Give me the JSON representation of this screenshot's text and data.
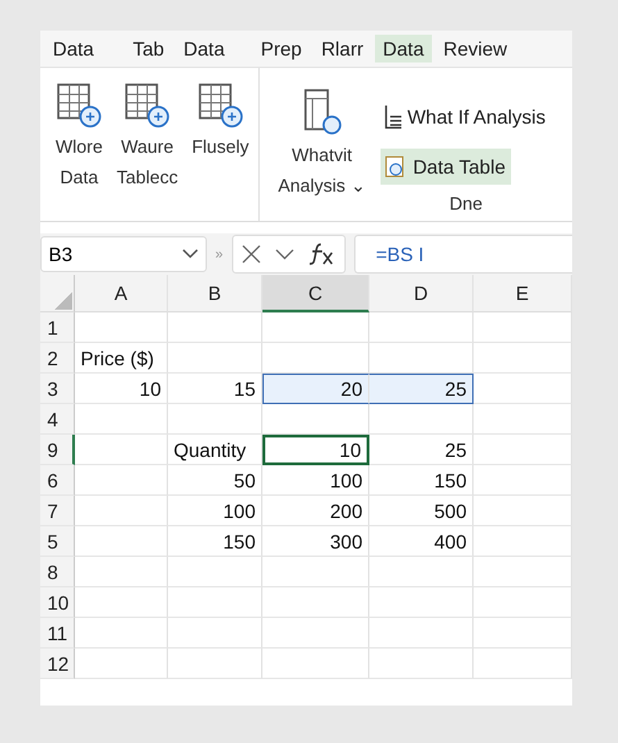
{
  "tabs": [
    {
      "label": "Data",
      "selected": false
    },
    {
      "label": "Tab",
      "selected": false
    },
    {
      "label": "Data",
      "selected": false
    },
    {
      "label": "Prep",
      "selected": false
    },
    {
      "label": "Rlarr",
      "selected": false
    },
    {
      "label": "Data",
      "selected": true
    },
    {
      "label": "Review",
      "selected": false
    }
  ],
  "ribbon": {
    "left_buttons": [
      {
        "lines": [
          "Wlore",
          "Data"
        ]
      },
      {
        "lines": [
          "Waure",
          "Tablecc"
        ]
      },
      {
        "lines": [
          "Flusely"
        ]
      }
    ],
    "analysis_button": {
      "lines": [
        "Whatvit",
        "Analysis"
      ],
      "caret": "⌄"
    },
    "small_buttons": [
      {
        "label": "What If Analysis",
        "selected": false
      },
      {
        "label": "Data Table",
        "selected": true
      }
    ],
    "group_label": "Dne"
  },
  "formula_bar": {
    "name_box": "B3",
    "separator": "»",
    "formula": "=BS I"
  },
  "sheet": {
    "columns": [
      {
        "label": "A",
        "selected": false
      },
      {
        "label": "B",
        "selected": false
      },
      {
        "label": "C",
        "selected": true
      },
      {
        "label": "D",
        "selected": false
      },
      {
        "label": "E",
        "selected": false
      }
    ],
    "rows": [
      {
        "label": "1",
        "selected": false,
        "cells": [
          {
            "selected": false,
            "active": false
          },
          {
            "selected": false,
            "active": false
          },
          {
            "selected": false,
            "active": false
          },
          {
            "selected": false,
            "active": false
          },
          {
            "selected": false,
            "active": false
          }
        ]
      },
      {
        "label": "2",
        "selected": false,
        "cells": [
          {
            "value": "Price ($)",
            "selected": false,
            "active": false
          },
          {
            "selected": false,
            "active": false
          },
          {
            "selected": false,
            "active": false
          },
          {
            "selected": false,
            "active": false
          },
          {
            "selected": false,
            "active": false
          }
        ]
      },
      {
        "label": "3",
        "selected": false,
        "cells": [
          {
            "value": "10",
            "selected": false,
            "active": false
          },
          {
            "value": "15",
            "selected": false,
            "active": false
          },
          {
            "value": "20",
            "selected": true,
            "active": false
          },
          {
            "value": "25",
            "selected": true,
            "active": false
          },
          {
            "selected": false,
            "active": false
          }
        ]
      },
      {
        "label": "4",
        "selected": false,
        "cells": [
          {
            "selected": false,
            "active": false
          },
          {
            "selected": false,
            "active": false
          },
          {
            "selected": false,
            "active": false
          },
          {
            "selected": false,
            "active": false
          },
          {
            "selected": false,
            "active": false
          }
        ]
      },
      {
        "label": "9",
        "selected": true,
        "cells": [
          {
            "selected": false,
            "active": false
          },
          {
            "value": "Quantity",
            "selected": false,
            "active": false
          },
          {
            "value": "10",
            "selected": false,
            "active": true
          },
          {
            "value": "25",
            "selected": false,
            "active": false
          },
          {
            "selected": false,
            "active": false
          }
        ]
      },
      {
        "label": "6",
        "selected": false,
        "cells": [
          {
            "selected": false,
            "active": false
          },
          {
            "value": "50",
            "selected": false,
            "active": false
          },
          {
            "value": "100",
            "selected": false,
            "active": false
          },
          {
            "value": "150",
            "selected": false,
            "active": false
          },
          {
            "selected": false,
            "active": false
          }
        ]
      },
      {
        "label": "7",
        "selected": false,
        "cells": [
          {
            "selected": false,
            "active": false
          },
          {
            "value": "100",
            "selected": false,
            "active": false
          },
          {
            "value": "200",
            "selected": false,
            "active": false
          },
          {
            "value": "500",
            "selected": false,
            "active": false
          },
          {
            "selected": false,
            "active": false
          }
        ]
      },
      {
        "label": "5",
        "selected": false,
        "cells": [
          {
            "selected": false,
            "active": false
          },
          {
            "value": "150",
            "selected": false,
            "active": false
          },
          {
            "value": "300",
            "selected": false,
            "active": false
          },
          {
            "value": "400",
            "selected": false,
            "active": false
          },
          {
            "selected": false,
            "active": false
          }
        ]
      },
      {
        "label": "8",
        "selected": false,
        "cells": [
          {
            "selected": false,
            "active": false
          },
          {
            "selected": false,
            "active": false
          },
          {
            "selected": false,
            "active": false
          },
          {
            "selected": false,
            "active": false
          },
          {
            "selected": false,
            "active": false
          }
        ]
      },
      {
        "label": "10",
        "selected": false,
        "cells": [
          {
            "selected": false,
            "active": false
          },
          {
            "selected": false,
            "active": false
          },
          {
            "selected": false,
            "active": false
          },
          {
            "selected": false,
            "active": false
          },
          {
            "selected": false,
            "active": false
          }
        ]
      },
      {
        "label": "11",
        "selected": false,
        "cells": [
          {
            "selected": false,
            "active": false
          },
          {
            "selected": false,
            "active": false
          },
          {
            "selected": false,
            "active": false
          },
          {
            "selected": false,
            "active": false
          },
          {
            "selected": false,
            "active": false
          }
        ]
      },
      {
        "label": "12",
        "selected": false,
        "cells": [
          {
            "selected": false,
            "active": false
          },
          {
            "selected": false,
            "active": false
          },
          {
            "selected": false,
            "active": false
          },
          {
            "selected": false,
            "active": false
          },
          {
            "selected": false,
            "active": false
          }
        ]
      }
    ]
  }
}
